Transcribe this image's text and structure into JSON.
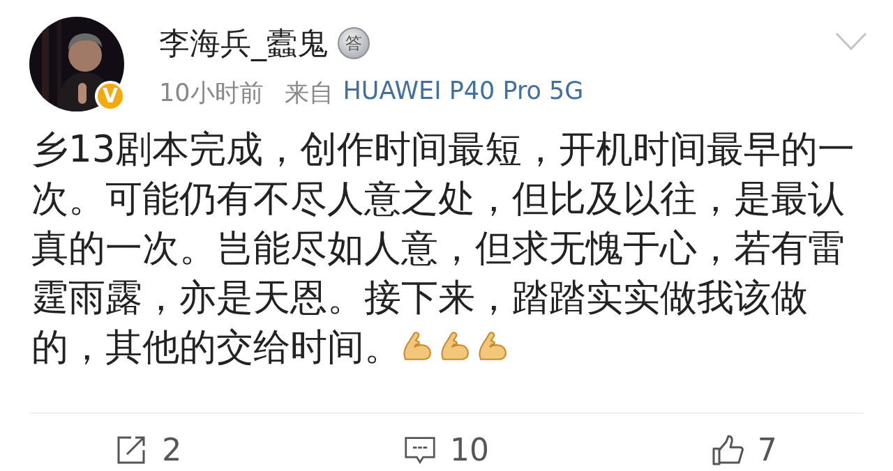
{
  "author": {
    "name": "李海兵_蠹鬼",
    "medal_badge": "答",
    "verified_badge": "V"
  },
  "meta": {
    "time": "10小时前",
    "source_prefix": "来自",
    "source": "HUAWEI P40 Pro 5G"
  },
  "post": {
    "text": "乡13剧本完成，创作时间最短，开机时间最早的一次。可能仍有不尽人意之处，但比及以往，是最认真的一次。岂能尽如人意，但求无愧于心，若有雷霆雨露，亦是天恩。接下来，踏踏实实做我该做的，其他的交给时间。",
    "emojis": [
      {
        "kind": "muscle"
      },
      {
        "kind": "muscle"
      },
      {
        "kind": "muscle"
      }
    ]
  },
  "actions": [
    {
      "kind": "repost",
      "count": "2"
    },
    {
      "kind": "comment",
      "count": "10"
    },
    {
      "kind": "like",
      "count": "7"
    }
  ]
}
